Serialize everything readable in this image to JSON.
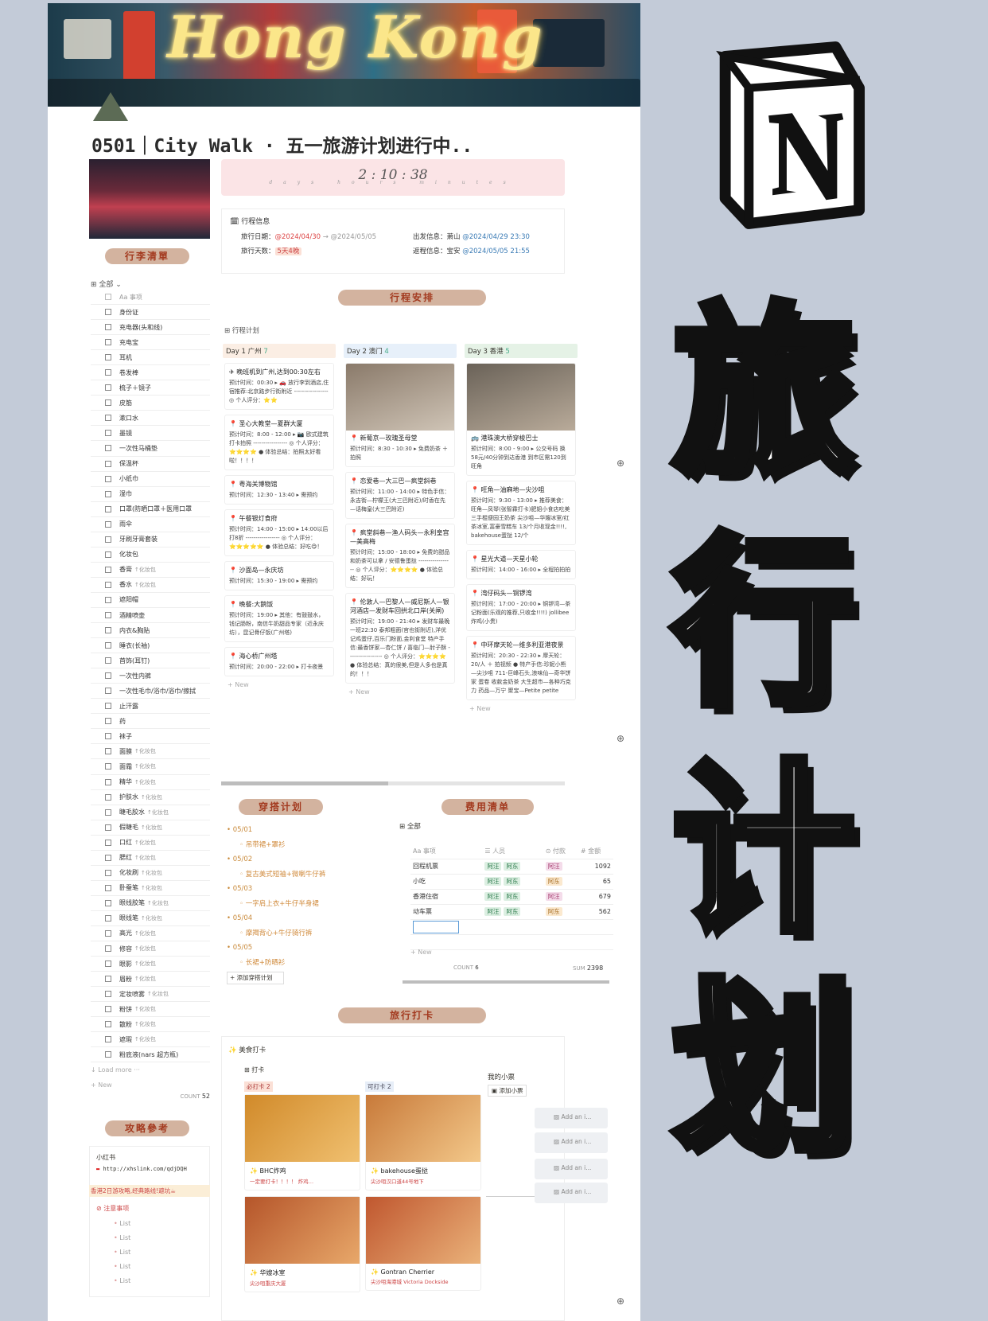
{
  "cover": {
    "title_art": "Hong Kong"
  },
  "page_title": "0501｜City Walk · 五一旅游计划进行中..",
  "pack": {
    "pill": "行李清單",
    "view": "全部",
    "header": "Aa 事项",
    "items": [
      {
        "n": "身份证",
        "t": ""
      },
      {
        "n": "充电器(头和线)",
        "t": ""
      },
      {
        "n": "充电宝",
        "t": ""
      },
      {
        "n": "耳机",
        "t": ""
      },
      {
        "n": "卷发棒",
        "t": ""
      },
      {
        "n": "梳子＋镜子",
        "t": ""
      },
      {
        "n": "皮筋",
        "t": ""
      },
      {
        "n": "漱口水",
        "t": ""
      },
      {
        "n": "墨镜",
        "t": ""
      },
      {
        "n": "一次性马桶垫",
        "t": ""
      },
      {
        "n": "保温杯",
        "t": ""
      },
      {
        "n": "小纸巾",
        "t": ""
      },
      {
        "n": "湿巾",
        "t": ""
      },
      {
        "n": "口罩(防晒口罩＋医用口罩",
        "t": ""
      },
      {
        "n": "雨伞",
        "t": ""
      },
      {
        "n": "牙刷牙膏套装",
        "t": ""
      },
      {
        "n": "化妆包",
        "t": ""
      },
      {
        "n": "香膏",
        "t": "↑化妆包"
      },
      {
        "n": "香水",
        "t": "↑化妆包"
      },
      {
        "n": "遮阳帽",
        "t": ""
      },
      {
        "n": "酒精喷壶",
        "t": ""
      },
      {
        "n": "内衣&胸贴",
        "t": ""
      },
      {
        "n": "睡衣(长袖)",
        "t": ""
      },
      {
        "n": "首饰(耳钉)",
        "t": ""
      },
      {
        "n": "一次性内裤",
        "t": ""
      },
      {
        "n": "一次性毛巾/浴巾/浴巾/擦拭",
        "t": ""
      },
      {
        "n": "止汗露",
        "t": ""
      },
      {
        "n": "药",
        "t": ""
      },
      {
        "n": "袜子",
        "t": ""
      },
      {
        "n": "面膜",
        "t": "↑化妆包"
      },
      {
        "n": "面霜",
        "t": "↑化妆包"
      },
      {
        "n": "精华",
        "t": "↑化妆包"
      },
      {
        "n": "护肤水",
        "t": "↑化妆包"
      },
      {
        "n": "睫毛胶水",
        "t": "↑化妆包"
      },
      {
        "n": "假睫毛",
        "t": "↑化妆包"
      },
      {
        "n": "口红",
        "t": "↑化妆包"
      },
      {
        "n": "腮红",
        "t": "↑化妆包"
      },
      {
        "n": "化妆刷",
        "t": "↑化妆包"
      },
      {
        "n": "卧蚕笔",
        "t": "↑化妆包"
      },
      {
        "n": "眼线胶笔",
        "t": "↑化妆包"
      },
      {
        "n": "眼线笔",
        "t": "↑化妆包"
      },
      {
        "n": "高光",
        "t": "↑化妆包"
      },
      {
        "n": "修容",
        "t": "↑化妆包"
      },
      {
        "n": "眼影",
        "t": "↑化妆包"
      },
      {
        "n": "眉粉",
        "t": "↑化妆包"
      },
      {
        "n": "定妆喷雾",
        "t": "↑化妆包"
      },
      {
        "n": "粉饼",
        "t": "↑化妆包"
      },
      {
        "n": "散粉",
        "t": "↑化妆包"
      },
      {
        "n": "遮瑕",
        "t": "↑化妆包"
      },
      {
        "n": "粉底液(nars 超方瓶)",
        "t": ""
      }
    ],
    "load_more": "↓ Load more ···",
    "new": "+ New",
    "count_label": "COUNT",
    "count": "52"
  },
  "timer": {
    "d": "2",
    "h": "10",
    "m": "38",
    "labels": "days hours minutes"
  },
  "info": {
    "title": "行程信息",
    "date_label": "旅行日期：",
    "date_from": "@2024/04/30",
    "date_sep": "→",
    "date_to": "@2024/05/05",
    "days_label": "旅行天数：",
    "days": "5天4晚",
    "dep_label": "出发信息：萧山",
    "dep": "@2024/04/29 23:30",
    "ret_label": "返程信息：宝安",
    "ret": "@2024/05/05 21:55"
  },
  "schedule": {
    "pill": "行程安排",
    "board": "行程计划",
    "cols": [
      {
        "hd": "Day 1 广州",
        "count": "7",
        "bg": "#fbeee4",
        "cards": [
          {
            "t": "✈ 晚班机到广州,达到00:30左右",
            "d": "预计时间：00:30 ▸ 🚗 放行李到酒店,住宿推荐:北京路步行街附近 ----------------- ◎ 个人评分：⭐⭐",
            "img": false
          },
          {
            "t": "📍 圣心大教堂—夏群大厦",
            "d": "预计时间：8:00 - 12:00 ▸ 📷 欧式建筑打卡拍照 ----------------- ◎ 个人评分：⭐⭐⭐⭐ ● 体验总结：拍照太好看啦！！！！",
            "img": false
          },
          {
            "t": "📍 粤海关博物馆",
            "d": "预计时间：12:30 - 13:40 ▸ 需预约",
            "img": false
          },
          {
            "t": "📍 午餐银灯食府",
            "d": "预计时间：14:00 - 15:00 ▸ 14:00以后打8折 ----------------- ◎ 个人评分：⭐⭐⭐⭐⭐ ● 体验总结：好吃😋！",
            "img": false
          },
          {
            "t": "📍 沙面岛—永庆坊",
            "d": "预计时间：15:30 - 19:00 ▸ 需预约",
            "img": false
          },
          {
            "t": "📍 晚餐:大鹅饭",
            "d": "预计时间：19:00 ▸ 其他：有鼓鼓水，钱记肠粉，南信牛奶甜品专家（近永庆坊），昆记骨仔饭(广州塔)",
            "img": false
          },
          {
            "t": "📍 海心桥广州塔",
            "d": "预计时间：20:00 - 22:00 ▸ 打卡夜景",
            "img": false
          }
        ]
      },
      {
        "hd": "Day 2 澳门",
        "count": "4",
        "bg": "#e7f0fa",
        "cards": [
          {
            "t": "📍 新葡京—玫瑰圣母堂",
            "d": "预计时间：8:30 - 10:30 ▸ 免费奶茶 ＋ 拍照",
            "img": true,
            "c1": "#8a7a6a",
            "c2": "#cfc4b6"
          },
          {
            "t": "📍 恋爱巷—大三巴—疯堂斜巷",
            "d": "预计时间：11:00 - 14:00 ▸ 特色手信：永吉街—柠檬王(大三巴附近)/时香在先—话梅皇(大三巴附近)",
            "img": false
          },
          {
            "t": "📍 疯堂斜巷—渔人码头—永利皇宫—美高梅",
            "d": "预计时间：15:00 - 18:00 ▸ 免费的甜品和奶茶可以拿 / 安德鲁蛋挞 ----------------- ◎ 个人评分：⭐⭐⭐⭐ ● 体验总结：好玩！",
            "img": false
          },
          {
            "t": "📍 伦敦人—巴黎人—威尼斯人—银河酒店—发财车回拱北口岸(关闸)",
            "d": "预计时间：19:00 - 21:40 ▸ 发财车最晚一班22:30 泰邦粗面(官也街附近),洋优记鸡蛋仔,百乐门粉面,金利食堂 特产手信:最香饼家—杏仁饼 / 喜临门—肘子酥 ----------------- ◎ 个人评分：⭐⭐⭐⭐ ● 体验总结：真的很美,但是人多也是真的！！！",
            "img": false
          }
        ]
      },
      {
        "hd": "Day 3 香港",
        "count": "5",
        "bg": "#e5f2e6",
        "cards": [
          {
            "t": "🚌 港珠澳大桥穿梭巴士",
            "d": "预计时间：8:00 - 9:00 ▸ 公交号码 换58元/40分钟到达香港 到市区需120到旺角",
            "img": true,
            "c1": "#6a6258",
            "c2": "#b9ab9a"
          },
          {
            "t": "📍 旺角—油麻地—尖沙咀",
            "d": "预计时间：9:30 - 13:00 ▸ 推荐美食：旺角—凤琴(张智霖打卡)肥姐小食店吃美三手棍便园王奶茶 尖沙咀—华嫂冰室/红茶冰室,富豪雪糕车 13/个月收现金!!!!, bakehouse蛋挞 12/个",
            "img": false
          },
          {
            "t": "📍 星光大道—天星小轮",
            "d": "预计时间：14:00 - 16:00 ▸ 全程拍拍拍",
            "img": false
          },
          {
            "t": "📍 湾仔码头—铜锣湾",
            "d": "预计时间：17:00 - 20:00 ▸ 铜锣湾—茶记粉面(乐观的推荐,只收金!!!!) jollibee炸鸡(小贵)",
            "img": false
          },
          {
            "t": "📍 中环摩天轮—维多利亚港夜景",
            "d": "预计时间：20:30 - 22:30 ▸ 摩天轮：20/人 ＋ 拍视频 ● 特产手信:珍妮小熊—尖沙咀 711-巨峰石头,浪味仙—奇华饼家 蛋卷 收款金奶茶 大生超市—各种巧克力 药品—万宁 聚宝—Petite petite",
            "img": false
          }
        ]
      }
    ],
    "new": "+ New"
  },
  "outfit": {
    "pill": "穿搭计划",
    "days": [
      {
        "d": "05/01",
        "i": "吊带裙+罩衫"
      },
      {
        "d": "05/02",
        "i": "复古美式短袖+微喇牛仔裤"
      },
      {
        "d": "05/03",
        "i": "一字肩上衣+牛仔半身裙"
      },
      {
        "d": "05/04",
        "i": "摩羯背心+牛仔骑行裤"
      },
      {
        "d": "05/05",
        "i": "长裙+防晒衫"
      }
    ],
    "add": "+ 添加穿搭计划"
  },
  "cost": {
    "pill": "费用清单",
    "view": "全部",
    "h": [
      "Aa 事项",
      "☰ 人员",
      "⊙ 付款",
      "# 金额"
    ],
    "rows": [
      {
        "n": "回程机票",
        "p": [
          "阿汪",
          "阿东"
        ],
        "pay": "阿汪",
        "pc": "p",
        "a": "1092"
      },
      {
        "n": "小吃",
        "p": [
          "阿汪",
          "阿东"
        ],
        "pay": "阿东",
        "pc": "o",
        "a": "65"
      },
      {
        "n": "香港住宿",
        "p": [
          "阿汪",
          "阿东"
        ],
        "pay": "阿汪",
        "pc": "p",
        "a": "679"
      },
      {
        "n": "动车票",
        "p": [
          "阿汪",
          "阿东"
        ],
        "pay": "阿东",
        "pc": "o",
        "a": "562"
      }
    ],
    "new": "+ New",
    "count_label": "COUNT",
    "count": "6",
    "sum_label": "SUM",
    "sum": "2398"
  },
  "checkin": {
    "pill": "旅行打卡",
    "title": "美食打卡",
    "board": "打卡",
    "g1": "必打卡",
    "g1c": "2",
    "g2": "可打卡",
    "g2c": "2",
    "cards": [
      {
        "n": "✨ BHC炸鸡",
        "d": "一定要打卡！！！！ 炸鸡…",
        "c1": "#d18a2a",
        "c2": "#f0c070"
      },
      {
        "n": "✨ bakehouse蛋挞",
        "d": "尖沙咀汉口道44号地下",
        "c1": "#c87a3a",
        "c2": "#f3c88a"
      },
      {
        "n": "✨ 华嫂冰室",
        "d": "尖沙咀重庆大厦",
        "c1": "#b5552a",
        "c2": "#e8a86a"
      },
      {
        "n": "✨ Gontran Cherrier",
        "d": "尖沙咀海港城 Victoria Dockside",
        "c1": "#c0572f",
        "c2": "#eab27a"
      }
    ],
    "tickets": "我的小票",
    "add_ticket": "添加小票",
    "add_img": "Add an i..."
  },
  "guide": {
    "pill": "攻略參考",
    "src": "小红书",
    "link": "http://xhslink.com/qdjDQH",
    "banner": "香港2日游攻略,经典路线!避坑☕",
    "note": "注意事项",
    "list": [
      "List",
      "List",
      "List",
      "List",
      "List"
    ]
  },
  "right": {
    "c1": "旅",
    "c2": "行",
    "c3": "计",
    "c4": "划"
  }
}
